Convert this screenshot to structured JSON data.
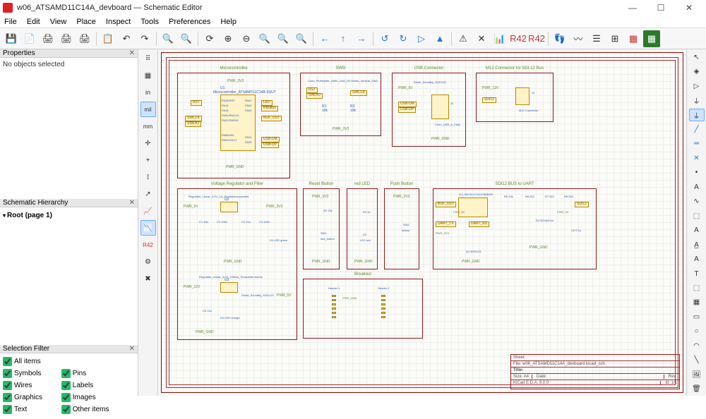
{
  "window": {
    "title": "w06_ATSAMD11C14A_devboard — Schematic Editor",
    "buttons": {
      "min": "—",
      "max": "☐",
      "close": "✕"
    }
  },
  "menu": [
    "File",
    "Edit",
    "View",
    "Place",
    "Inspect",
    "Tools",
    "Preferences",
    "Help"
  ],
  "toolbar_icons": [
    "save",
    "sheet-settings",
    "print",
    "plot",
    "paste",
    "",
    "undo",
    "redo",
    "",
    "find",
    "find-replace",
    "",
    "refresh",
    "zoom-in",
    "zoom-out",
    "zoom-fit",
    "zoom-obj",
    "zoom-sel",
    "",
    "nav-back",
    "nav-up",
    "nav-fwd",
    "",
    "rotate-ccw",
    "rotate-cw",
    "mirror-v",
    "mirror-h",
    "",
    "erc",
    "no-erc",
    "sim",
    "annotate",
    "",
    "footprint",
    "bom",
    "export",
    "netlist",
    "pcb",
    "pcb-update"
  ],
  "panels": {
    "properties": {
      "title": "Properties",
      "body": "No objects selected"
    },
    "hierarchy": {
      "title": "Schematic Hierarchy",
      "root": "Root (page 1)"
    },
    "filter": {
      "title": "Selection Filter",
      "items": [
        "All items",
        "Symbols",
        "Pins",
        "Wires",
        "Labels",
        "Graphics",
        "Images",
        "Text",
        "Other items"
      ]
    }
  },
  "left_tools": [
    "grid-dots",
    "grid-lines",
    "in",
    "mil",
    "mm",
    "cursor-full",
    "cursor-sm",
    "hidden-pins",
    "dir-arrow",
    "plot1",
    "plot2",
    "erc-icon",
    "script",
    "settings"
  ],
  "right_tools": [
    "select",
    "highlight",
    "net",
    "bus",
    "wire-entry",
    "bus-entry",
    "no-connect",
    "junction",
    "label",
    "net-class",
    "global-label",
    "hier-label",
    "hier-sheet",
    "import-sheet",
    "power",
    "symbol",
    "text",
    "textbox",
    "rect",
    "circle",
    "arc",
    "line",
    "image",
    "delete"
  ],
  "schematic": {
    "blocks": {
      "mcu": {
        "title": "Microcontroller",
        "ref": "U1",
        "val": "Microcontroller_ATSAMD11C14A-SSUT",
        "nets_l": [
          "RST",
          "SWCLK",
          "SWDIO"
        ],
        "nets_r": [
          "LED",
          "RButton",
          "BUF_OUT",
          "USB-DM",
          "USB-DP"
        ],
        "pins_l": [
          "PA28/RST",
          "PA14",
          "PA15",
          "PA30/SWCLK",
          "PA31/SWDIO",
          "PA08/XIN",
          "PA09/XOUT"
        ],
        "pins_r": [
          "PA02",
          "PA04",
          "PA05",
          "PA24",
          "PA25"
        ],
        "pwr": "PWR_3V3",
        "gnd": "PWR_GND"
      },
      "swd": {
        "title": "SWD",
        "val": "Conn_PinHeader_SWD_2x02_P2.54mm_Vertical_SWD",
        "nets": [
          "RST",
          "SWDIO",
          "SWCLK"
        ],
        "r": [
          "R1",
          "10k",
          "R3",
          "10k"
        ],
        "pwr": "PWR_3V3"
      },
      "usb": {
        "title": "USB Connector",
        "diode": "Diode_Schottky_SOD123",
        "ref": "J2",
        "val": "Conn_USB_A_Plain",
        "nets": [
          "USB-DM",
          "USB-DP"
        ],
        "pwr": "PWR_5V",
        "gnd": "PWR_GND"
      },
      "m12": {
        "title": "M12 Connector for SDI-12 Bus",
        "ref": "J3",
        "val": "M12 Connector",
        "pwr": "PWR_12V",
        "io": "SDI12"
      },
      "reg": {
        "title": "Voltage Regulator and Filter",
        "reg1": "Regulator_Linear_3.3V_1A_Diodesincorporated",
        "reg1ref": "U2",
        "reg2": "Regulator_Linear_5.0V_100mA_TexasInstruments",
        "reg2ref": "U3",
        "caps": [
          "C1 10u",
          "C2 10u",
          "C3 100n",
          "C4 100n",
          "C5 10u"
        ],
        "leds": [
          "D1 LED green",
          "D4 LED orange"
        ],
        "diode": "Diode_Schottky_SOD123",
        "in": "PWR_5V",
        "out": "PWR_3V3",
        "in2": "PWR_12V",
        "out2": "PWR_5V",
        "gnd": "PWR_GND"
      },
      "rbtn": {
        "title": "Reset Button",
        "ref": "SW1",
        "val": "tact_button",
        "r": "R2 10k",
        "pwr": "PWR_3V3",
        "gnd": "PWR_GND"
      },
      "led": {
        "title": "red LED",
        "ref": "D2",
        "val": "LED red",
        "r": "R4 1k",
        "gnd": "PWR_GND"
      },
      "pbtn": {
        "title": "Push Button",
        "ref": "SW2",
        "val": "tactsw",
        "pwr": "PWR_3V3"
      },
      "sdi": {
        "title": "SDI12 BUS to UART",
        "ic": "IC1 SN74LVC1G125DBVR",
        "d": "D3 BZX84Cxx",
        "nets": [
          "BUF_OUT",
          "UART_TX",
          "UART_RX",
          "SDI12"
        ],
        "r": [
          "R5 10k",
          "R6 510",
          "R7 510",
          "R8 510"
        ],
        "q": "Q1 BSS123",
        "c": "C6 0.1u",
        "pwr": [
          "PWR_5V",
          "PWR_3V3"
        ],
        "gnd": "PWR_GND"
      },
      "brk": {
        "title": "Breakout",
        "h1": "Header 1",
        "h2": "Header 2",
        "gnd": "PWR_GND"
      }
    },
    "titleblock": {
      "sheet": "Sheet:",
      "file": "File: w06_ATSAMD11C14A_devboard.kicad_sch",
      "title": "Title:",
      "size": "Size: A4",
      "date": "Date:",
      "rev": "Rev:",
      "app": "KiCad E.D.A. 9.0.0",
      "id": "Id: 1/1"
    }
  }
}
